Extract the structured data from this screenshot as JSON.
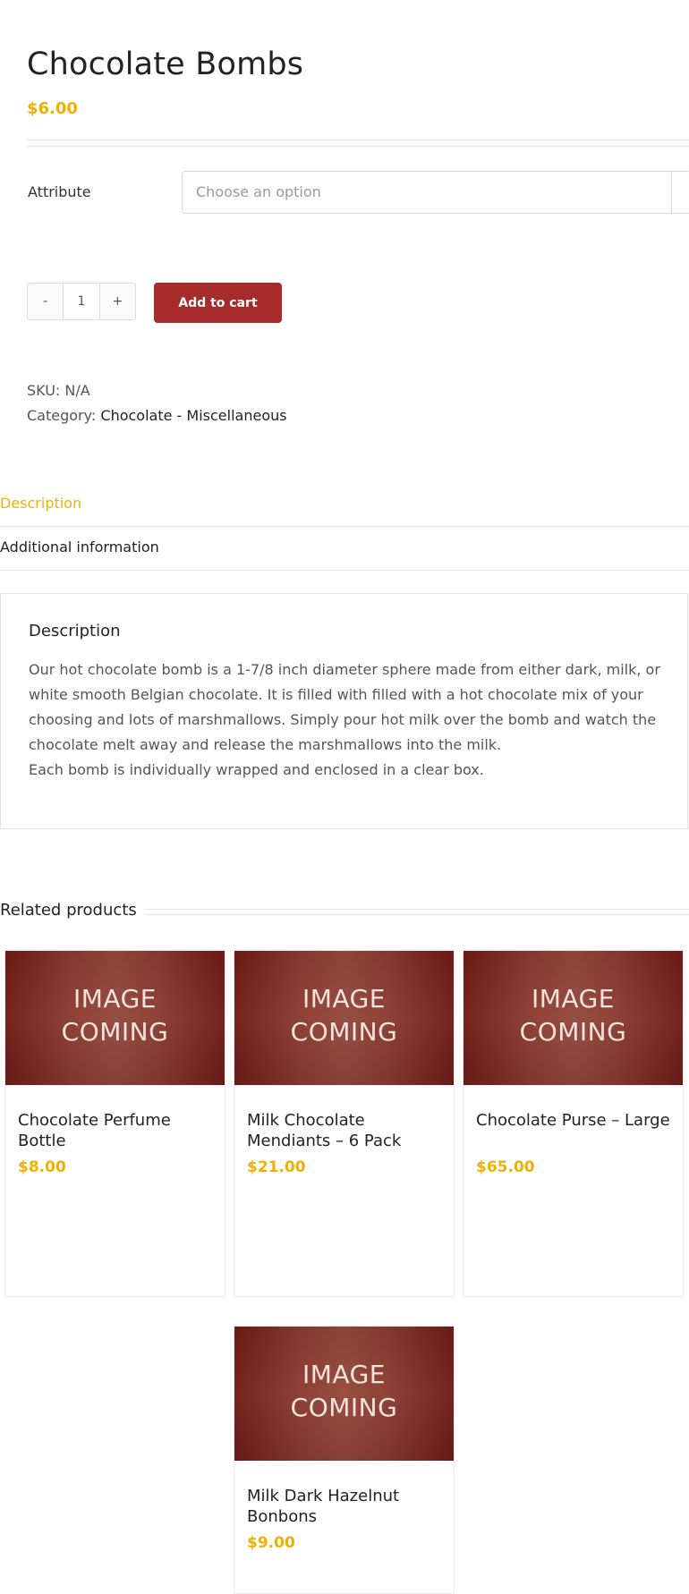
{
  "product": {
    "title": "Chocolate Bombs",
    "price": "$6.00",
    "attribute_label": "Attribute",
    "attribute_placeholder": "Choose an option",
    "quantity_minus": "-",
    "quantity_value": "1",
    "quantity_plus": "+",
    "add_to_cart": "Add to cart",
    "sku_label": "SKU:",
    "sku_value": "N/A",
    "category_label": "Category:",
    "category_value": "Chocolate - Miscellaneous"
  },
  "tabs": [
    {
      "label": "Description",
      "active": true
    },
    {
      "label": "Additional information",
      "active": false
    }
  ],
  "description": {
    "heading": "Description",
    "paragraph1": "Our hot chocolate bomb is a 1-7/8 inch diameter sphere made from either dark, milk, or white smooth Belgian chocolate. It is filled with filled with a hot chocolate mix of your choosing and lots of marshmallows. Simply pour hot milk over the bomb and watch the chocolate melt away and release the marshmallows into the milk.",
    "paragraph2": "Each bomb is individually wrapped and enclosed in a clear box."
  },
  "related": {
    "heading": "Related products",
    "image_placeholder_line1": "IMAGE",
    "image_placeholder_line2": "COMING",
    "products": [
      {
        "name": "Chocolate Perfume Bottle",
        "price": "$8.00"
      },
      {
        "name": "Milk Chocolate Mendiants – 6 Pack",
        "price": "$21.00"
      },
      {
        "name": "Chocolate Purse – Large",
        "price": "$65.00"
      },
      {
        "name": "Milk Dark Hazelnut Bonbons",
        "price": "$9.00"
      }
    ]
  },
  "colors": {
    "accent_gold": "#f0b000",
    "button_red": "#a82b2b",
    "image_placeholder": "#8a3a30"
  }
}
